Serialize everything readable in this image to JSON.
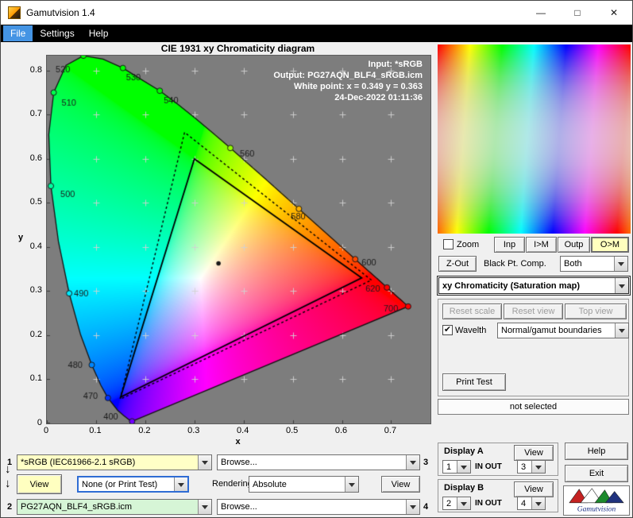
{
  "window": {
    "title": "Gamutvision 1.4"
  },
  "titlebar_controls": {
    "minimize": "—",
    "maximize": "□",
    "close": "✕"
  },
  "menu": {
    "items": [
      {
        "label": "File"
      },
      {
        "label": "Settings"
      },
      {
        "label": "Help"
      }
    ]
  },
  "icons": {
    "check": "✔",
    "down_arrow": "↓"
  },
  "chart": {
    "title": "CIE 1931 xy Chromaticity diagram",
    "annotations": [
      "Input:  *sRGB",
      "Output: PG27AQN_BLF4_sRGB.icm",
      "White point:  x = 0.349  y = 0.363",
      "24-Dec-2022 01:11:36"
    ],
    "xlabel": "x",
    "ylabel": "y"
  },
  "chart_data": {
    "type": "chromaticity-diagram",
    "title": "CIE 1931 xy Chromaticity diagram",
    "xlabel": "x",
    "ylabel": "y",
    "xlim": [
      0,
      0.78
    ],
    "ylim": [
      0,
      0.834
    ],
    "x_ticks": [
      0,
      0.1,
      0.2,
      0.3,
      0.4,
      0.5,
      0.6,
      0.7
    ],
    "y_ticks": [
      0,
      0.1,
      0.2,
      0.3,
      0.4,
      0.5,
      0.6,
      0.7,
      0.8
    ],
    "white_point": {
      "x": 0.349,
      "y": 0.363
    },
    "gamuts": [
      {
        "name": "input-sRGB",
        "style": "solid",
        "points": [
          [
            0.64,
            0.33
          ],
          [
            0.3,
            0.6
          ],
          [
            0.15,
            0.06
          ]
        ]
      },
      {
        "name": "output-PG27AQN_BLF4_sRGB",
        "style": "dotted",
        "points": [
          [
            0.66,
            0.325
          ],
          [
            0.28,
            0.66
          ],
          [
            0.149,
            0.055
          ]
        ]
      }
    ],
    "wavelength_labels": [
      {
        "wl": "400",
        "x": 0.1733,
        "y": 0.0048,
        "dx": -36,
        "dy": -2
      },
      {
        "wl": "470",
        "x": 0.1241,
        "y": 0.0578,
        "dx": -31,
        "dy": 1
      },
      {
        "wl": "480",
        "x": 0.0913,
        "y": 0.1327,
        "dx": -30,
        "dy": 4
      },
      {
        "wl": "490",
        "x": 0.0454,
        "y": 0.295,
        "dx": 6,
        "dy": 4
      },
      {
        "wl": "500",
        "x": 0.0082,
        "y": 0.5384,
        "dx": 12,
        "dy": 14
      },
      {
        "wl": "510",
        "x": 0.0139,
        "y": 0.7502,
        "dx": 10,
        "dy": 16
      },
      {
        "wl": "520",
        "x": 0.0743,
        "y": 0.8338,
        "dx": -35,
        "dy": 21
      },
      {
        "wl": "530",
        "x": 0.1547,
        "y": 0.8059,
        "dx": 4,
        "dy": 15
      },
      {
        "wl": "540",
        "x": 0.2296,
        "y": 0.7543,
        "dx": 5,
        "dy": 16
      },
      {
        "wl": "560",
        "x": 0.3731,
        "y": 0.6245,
        "dx": 12,
        "dy": 11
      },
      {
        "wl": "580",
        "x": 0.5125,
        "y": 0.4866,
        "dx": -10,
        "dy": 13
      },
      {
        "wl": "600",
        "x": 0.627,
        "y": 0.3725,
        "dx": 8,
        "dy": 8
      },
      {
        "wl": "620",
        "x": 0.6915,
        "y": 0.3083,
        "dx": -27,
        "dy": 5
      },
      {
        "wl": "700",
        "x": 0.7347,
        "y": 0.2653,
        "dx": -31,
        "dy": 6
      }
    ],
    "spectral_locus": [
      [
        380,
        0.1741,
        0.005
      ],
      [
        390,
        0.1738,
        0.0049
      ],
      [
        400,
        0.1733,
        0.0048
      ],
      [
        410,
        0.1726,
        0.0048
      ],
      [
        420,
        0.1714,
        0.0051
      ],
      [
        430,
        0.1689,
        0.0069
      ],
      [
        440,
        0.1644,
        0.0109
      ],
      [
        450,
        0.1566,
        0.0177
      ],
      [
        460,
        0.144,
        0.0297
      ],
      [
        470,
        0.1241,
        0.0578
      ],
      [
        475,
        0.1096,
        0.0868
      ],
      [
        480,
        0.0913,
        0.1327
      ],
      [
        485,
        0.0687,
        0.2007
      ],
      [
        490,
        0.0454,
        0.295
      ],
      [
        495,
        0.0235,
        0.4127
      ],
      [
        500,
        0.0082,
        0.5384
      ],
      [
        505,
        0.0039,
        0.6548
      ],
      [
        510,
        0.0139,
        0.7502
      ],
      [
        515,
        0.0389,
        0.812
      ],
      [
        520,
        0.0743,
        0.8338
      ],
      [
        525,
        0.1142,
        0.8262
      ],
      [
        530,
        0.1547,
        0.8059
      ],
      [
        535,
        0.1896,
        0.7816
      ],
      [
        540,
        0.2296,
        0.7543
      ],
      [
        545,
        0.2658,
        0.7243
      ],
      [
        550,
        0.3016,
        0.6923
      ],
      [
        555,
        0.3373,
        0.6589
      ],
      [
        560,
        0.3731,
        0.6245
      ],
      [
        565,
        0.4087,
        0.5896
      ],
      [
        570,
        0.4441,
        0.5547
      ],
      [
        575,
        0.4788,
        0.5202
      ],
      [
        580,
        0.5125,
        0.4866
      ],
      [
        585,
        0.5448,
        0.4544
      ],
      [
        590,
        0.5752,
        0.4242
      ],
      [
        595,
        0.6029,
        0.3965
      ],
      [
        600,
        0.627,
        0.3725
      ],
      [
        605,
        0.6482,
        0.3514
      ],
      [
        610,
        0.6658,
        0.334
      ],
      [
        620,
        0.6915,
        0.3083
      ],
      [
        630,
        0.7079,
        0.292
      ],
      [
        640,
        0.719,
        0.2809
      ],
      [
        650,
        0.726,
        0.274
      ],
      [
        680,
        0.7334,
        0.2666
      ],
      [
        700,
        0.7347,
        0.2653
      ]
    ]
  },
  "right_panel": {
    "zoom_label": "Zoom",
    "inp": "Inp",
    "im": "I>M",
    "outp": "Outp",
    "om": "O>M",
    "zout": "Z-Out",
    "black_pt_label": "Black Pt. Comp.",
    "black_pt_value": "Both",
    "view_mode": "xy Chromaticity (Saturation map)",
    "reset_scale": "Reset scale",
    "reset_view": "Reset view",
    "top_view": "Top view",
    "wavelth_label": "Wavelth",
    "wavelth_value": "Normal/gamut boundaries",
    "print_test": "Print Test",
    "status": "not selected",
    "display_a": {
      "title": "Display A",
      "view": "View",
      "in_value": "1",
      "in_out": "IN OUT",
      "out_value": "3"
    },
    "display_b": {
      "title": "Display B",
      "view": "View",
      "in_value": "2",
      "in_out": "IN OUT",
      "out_value": "4"
    },
    "help": "Help",
    "exit": "Exit",
    "logo_text": "Gamutvision"
  },
  "bottom_panel": {
    "row1": {
      "num": "1",
      "profile": "*sRGB   (IEC61966-2.1 sRGB)",
      "browse": "Browse...",
      "num_right": "3"
    },
    "row2": {
      "view_left": "View",
      "test_pattern": "None (or Print Test)",
      "rendering_label": "Rendering",
      "intent": "Absolute",
      "view_right": "View"
    },
    "row3": {
      "num": "2",
      "profile": "PG27AQN_BLF4_sRGB.icm",
      "browse": "Browse...",
      "num_right": "4"
    }
  },
  "colors": {
    "plot_bg": "#7d7d7d",
    "highlight_yellow": "#ffffc0",
    "profile1_bg": "#ffffc6",
    "profile2_bg": "#d6f5d6",
    "menu_highlight": "#4494e4"
  }
}
